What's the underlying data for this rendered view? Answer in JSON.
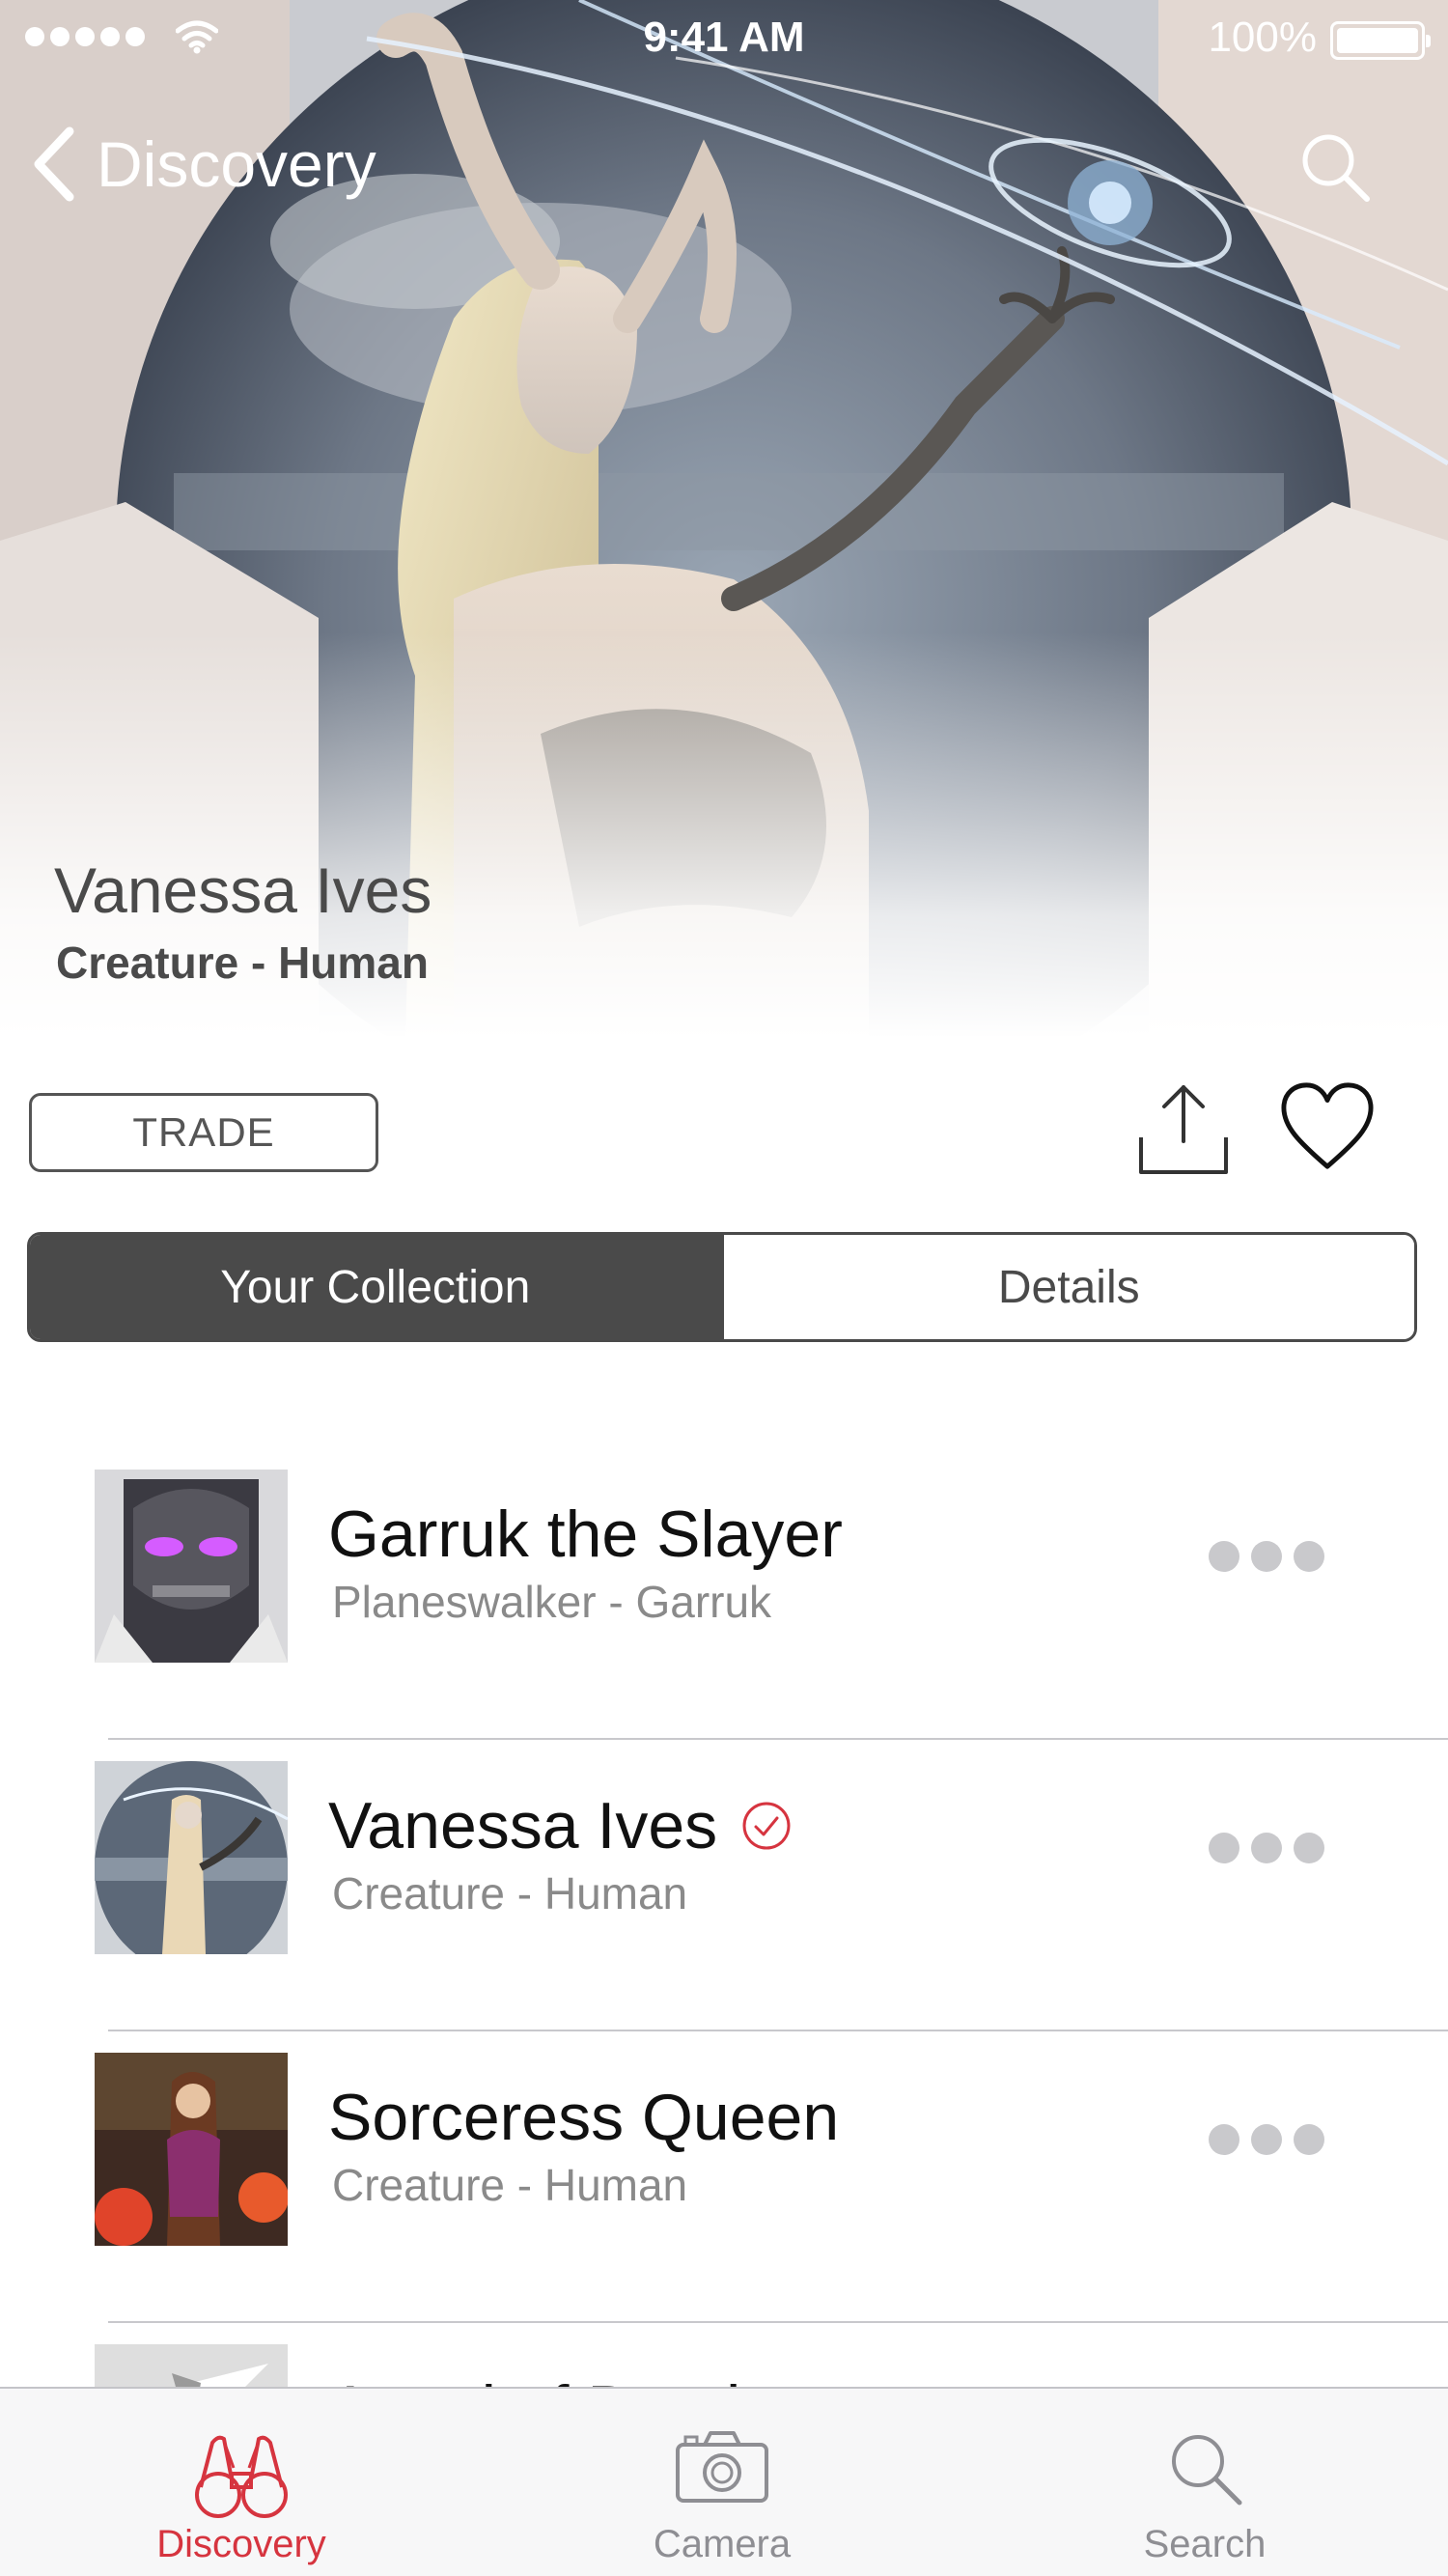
{
  "status_bar": {
    "time": "9:41 AM",
    "battery": "100%",
    "signal_bars": 5
  },
  "nav": {
    "back_label": "Discovery",
    "back_icon": "chevron-left-icon",
    "search_icon": "search-icon"
  },
  "hero": {
    "title": "Vanessa Ives",
    "subtitle": "Creature - Human"
  },
  "actions": {
    "trade_label": "TRADE",
    "share_icon": "share-icon",
    "favorite_icon": "heart-icon"
  },
  "segmented": {
    "tabs": [
      "Your Collection",
      "Details"
    ],
    "selected": "Your Collection"
  },
  "list": {
    "items": [
      {
        "title": "Garruk the Slayer",
        "subtitle": "Planeswalker - Garruk",
        "verified": false,
        "more_icon": "ellipsis-icon"
      },
      {
        "title": "Vanessa Ives",
        "subtitle": "Creature - Human",
        "verified": true,
        "more_icon": "ellipsis-icon"
      },
      {
        "title": "Sorceress Queen",
        "subtitle": "Creature - Human",
        "verified": false,
        "more_icon": "ellipsis-icon"
      },
      {
        "title": "Angel of Death",
        "subtitle": "",
        "verified": false,
        "more_icon": "ellipsis-icon"
      }
    ]
  },
  "tab_bar": {
    "tabs": [
      {
        "label": "Discovery",
        "icon": "binoculars-icon",
        "active": true
      },
      {
        "label": "Camera",
        "icon": "camera-icon",
        "active": false
      },
      {
        "label": "Search",
        "icon": "search-icon",
        "active": false
      }
    ]
  },
  "colors": {
    "accent": "#d6343f",
    "segment_dark": "#4a4a4a",
    "secondary_text": "#8a8a8a"
  }
}
